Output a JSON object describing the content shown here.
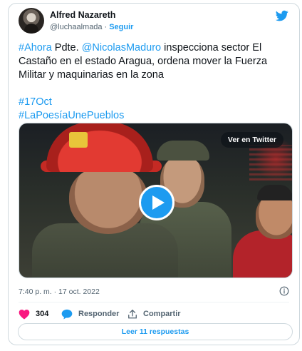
{
  "author": {
    "name": "Alfred Nazareth",
    "handle": "@luchaalmada",
    "separator": "·",
    "follow_label": "Seguir"
  },
  "tweet": {
    "line1": {
      "hashtag": "#Ahora",
      "text_a": " Pdte. ",
      "mention": "@NicolasMaduro",
      "text_b": " inspecciona sector El Castaño en el estado Aragua, ordena mover la Fuerza Militar y maquinarias en la zona"
    },
    "hashtag2": "#17Oct",
    "hashtag3": "#LaPoesíaUnePueblos"
  },
  "media": {
    "watch_label": "Ver en Twitter"
  },
  "meta": {
    "timestamp": "7:40 p. m. · 17 oct. 2022"
  },
  "actions": {
    "like_count": "304",
    "reply_label": "Responder",
    "share_label": "Compartir"
  },
  "replies_button": "Leer 11 respuestas",
  "colors": {
    "accent": "#1d9bf0",
    "like": "#f91880",
    "text": "#0f1419",
    "secondary": "#536471"
  }
}
